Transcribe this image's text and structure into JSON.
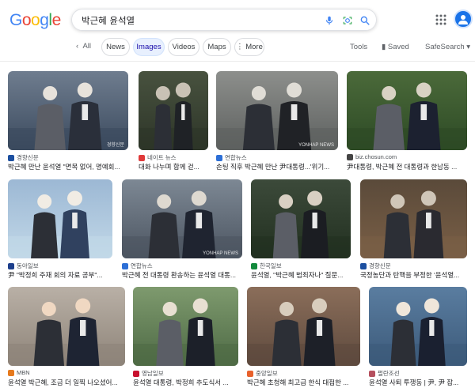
{
  "logo": {
    "letters": [
      "G",
      "o",
      "o",
      "g",
      "l",
      "e"
    ],
    "colors": [
      "#4285f4",
      "#ea4335",
      "#fbbc05",
      "#4285f4",
      "#34a853",
      "#ea4335"
    ]
  },
  "search": {
    "query": "박근혜 윤석열"
  },
  "icons": {
    "mic": "mic-icon",
    "lens": "lens-icon",
    "search": "search-icon",
    "apps": "apps-grid-icon",
    "avatar": "account-avatar"
  },
  "nav": {
    "back_label": "All",
    "chips": [
      "News",
      "Images",
      "Videos",
      "Maps",
      "More"
    ],
    "active": "Images",
    "tools": "Tools",
    "saved": "Saved",
    "safesearch": "SafeSearch"
  },
  "accent": "#1a73e8",
  "results": [
    {
      "source": "경향신문",
      "caption": "박근혜 만난 윤석열 \"면목 없어, 명예회...",
      "watermark": "경향신문",
      "fav": "#1c4fa0"
    },
    {
      "source": "네이트 뉴스",
      "caption": "대화 나누며 함께 걷...",
      "watermark": "",
      "fav": "#e03a3a"
    },
    {
      "source": "연합뉴스",
      "caption": "손팅 직후 박근혜 만난 尹대통령...'위기...",
      "watermark": "YONHAP NEWS",
      "fav": "#2d6fd6"
    },
    {
      "source": "biz.chosun.com",
      "caption": "尹대통령, 박근혜 전 대통령과 한남동 ...",
      "watermark": "",
      "fav": "#444444"
    },
    {
      "source": "동아일보",
      "caption": "尹 \"박정희 주재 회의 자료 공부\"...",
      "watermark": "",
      "fav": "#1d3f8c"
    },
    {
      "source": "연합뉴스",
      "caption": "박근혜 전 대통령 환송하는 윤석열 대통...",
      "watermark": "YONHAP NEWS",
      "fav": "#2d6fd6"
    },
    {
      "source": "한국일보",
      "caption": "윤석열, \"박근혜 범죄자나\" 질문...",
      "watermark": "",
      "fav": "#138a3c"
    },
    {
      "source": "경향신문",
      "caption": "국정농단과 탄핵을 부정한 '윤석열...",
      "watermark": "",
      "fav": "#1c4fa0"
    },
    {
      "source": "MBN",
      "caption": "윤석열 박근혜, 조금 더 일찍 나오셨어...",
      "watermark": "",
      "fav": "#e67a1e"
    },
    {
      "source": "영남일보",
      "caption": "윤석열 대통령, 박정희 추도식서 ...",
      "watermark": "",
      "fav": "#c8102e"
    },
    {
      "source": "중앙일보",
      "caption": "박근혜 초청해 최고급 한식 대접한 ...",
      "watermark": "",
      "fav": "#e8612c"
    },
    {
      "source": "펄란조선",
      "caption": "윤석열 사퇴 투쟁동 | 尹, 尹 잡...",
      "watermark": "",
      "fav": "#b5505e"
    }
  ]
}
